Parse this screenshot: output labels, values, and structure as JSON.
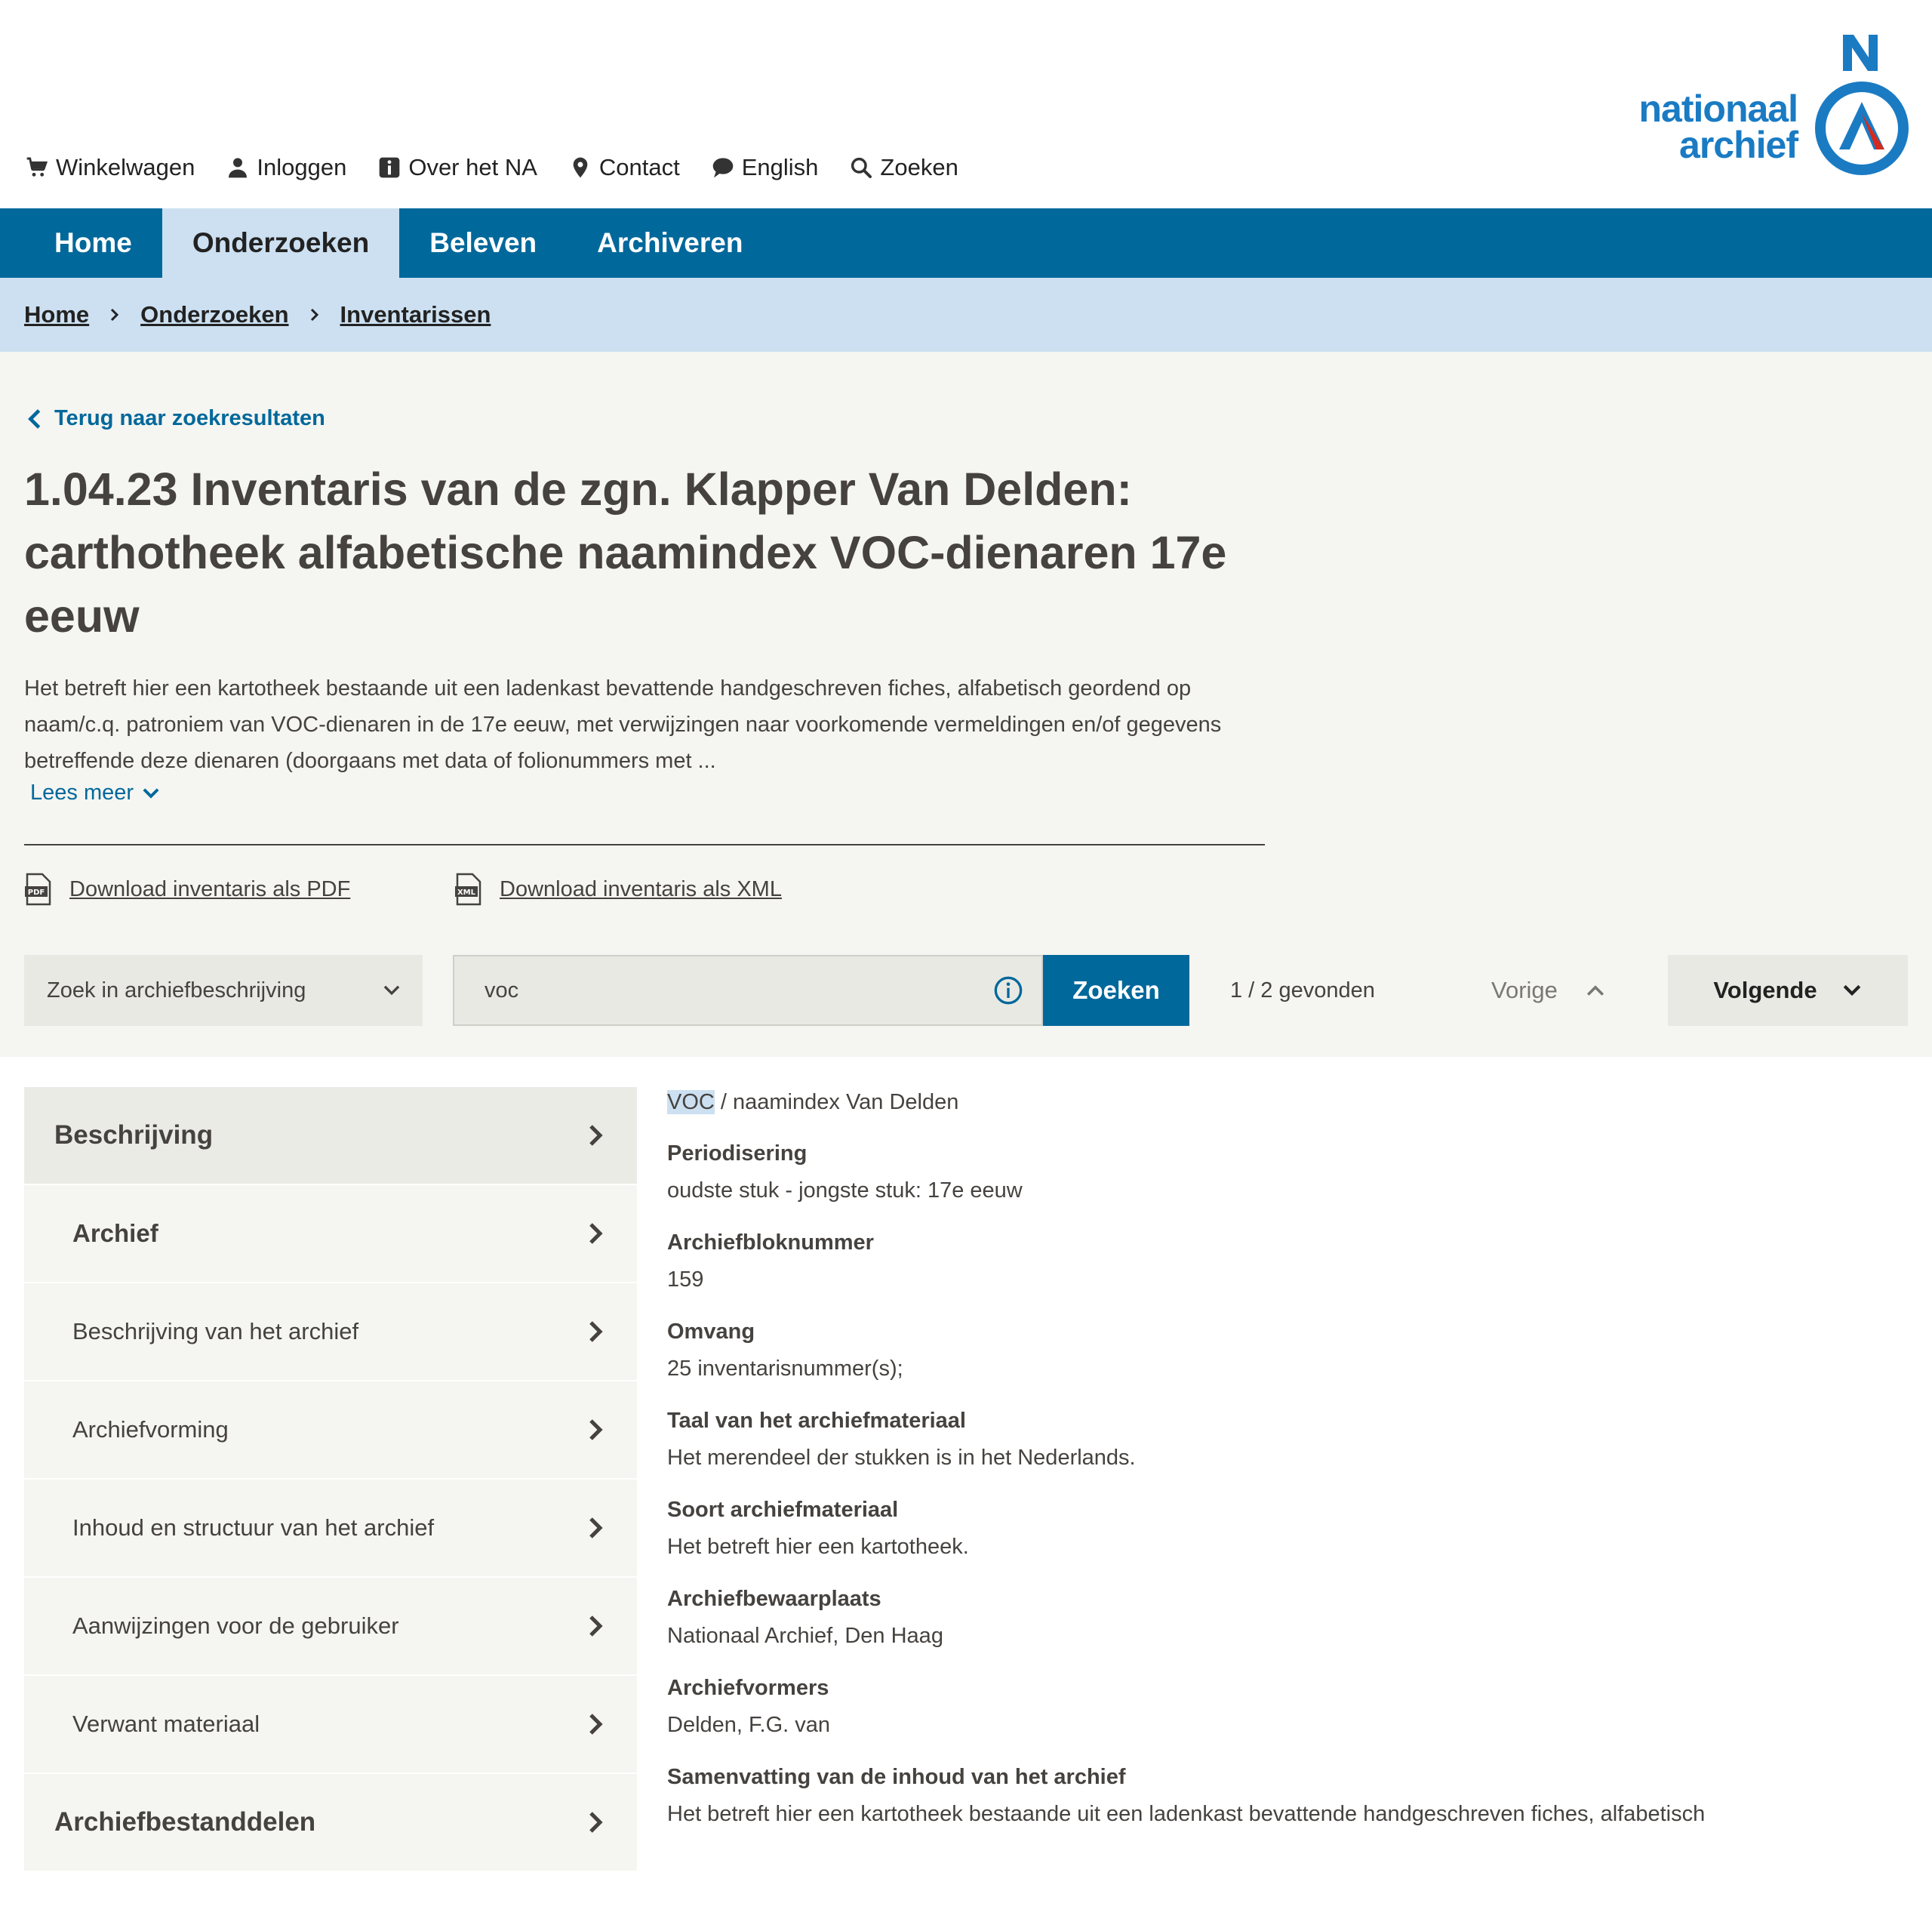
{
  "utility": {
    "links": [
      {
        "label": "Winkelwagen",
        "icon": "cart-icon"
      },
      {
        "label": "Inloggen",
        "icon": "user-icon"
      },
      {
        "label": "Over het NA",
        "icon": "info-icon"
      },
      {
        "label": "Contact",
        "icon": "location-pin-icon"
      },
      {
        "label": "English",
        "icon": "speech-bubble-icon"
      },
      {
        "label": "Zoeken",
        "icon": "search-icon"
      }
    ]
  },
  "logo": {
    "line1": "nationaal",
    "line2": "archief",
    "brand_color": "#1a7bc3",
    "accent_color": "#d52b1e"
  },
  "mainnav": {
    "items": [
      {
        "label": "Home"
      },
      {
        "label": "Onderzoeken"
      },
      {
        "label": "Beleven"
      },
      {
        "label": "Archiveren"
      }
    ],
    "active": "Onderzoeken",
    "color": "#01689b"
  },
  "breadcrumb": [
    "Home",
    "Onderzoeken",
    "Inventarissen"
  ],
  "hero": {
    "back_label": "Terug naar zoekresultaten",
    "title": "1.04.23 Inventaris van de zgn. Klapper Van Delden: carthotheek alfabetische naamindex VOC-dienaren 17e eeuw",
    "intro": "Het betreft hier een kartotheek bestaande uit een ladenkast bevattende handgeschreven fiches, alfabetisch geordend op naam/c.q. patroniem van VOC-dienaren in de 17e eeuw, met verwijzingen naar voorkomende vermeldingen en/of gegevens betreffende deze dienaren (doorgaans met data of folionummers met ...",
    "read_more": "Lees meer",
    "download_pdf": "Download inventaris als PDF",
    "download_xml": "Download inventaris als XML"
  },
  "search": {
    "scope": "Zoek in archiefbeschrijving",
    "value": "voc",
    "button": "Zoeken",
    "count": "1 / 2 gevonden",
    "prev": "Vorige",
    "next": "Volgende"
  },
  "sidebar": {
    "items": [
      {
        "label": "Beschrijving",
        "level": 0
      },
      {
        "label": "Archief",
        "level": 1
      },
      {
        "label": "Beschrijving van het archief",
        "level": 2
      },
      {
        "label": "Archiefvorming",
        "level": 2
      },
      {
        "label": "Inhoud en structuur van het archief",
        "level": 2
      },
      {
        "label": "Aanwijzingen voor de gebruiker",
        "level": 2
      },
      {
        "label": "Verwant materiaal",
        "level": 2
      },
      {
        "label": "Archiefbestanddelen",
        "level": 0
      }
    ]
  },
  "content": {
    "path_highlight": "VOC",
    "path_rest": " / naamindex Van Delden",
    "fields": [
      {
        "label": "Periodisering",
        "value": "oudste stuk - jongste stuk: 17e eeuw"
      },
      {
        "label": "Archiefbloknummer",
        "value": "159"
      },
      {
        "label": "Omvang",
        "value": "25 inventarisnummer(s);"
      },
      {
        "label": "Taal van het archiefmateriaal",
        "value": "Het merendeel der stukken is in het Nederlands."
      },
      {
        "label": "Soort archiefmateriaal",
        "value": "Het betreft hier een kartotheek."
      },
      {
        "label": "Archiefbewaarplaats",
        "value": "Nationaal Archief, Den Haag"
      },
      {
        "label": "Archiefvormers",
        "value": "Delden, F.G. van"
      },
      {
        "label": "Samenvatting van de inhoud van het archief",
        "value": "Het betreft hier een kartotheek bestaande uit een ladenkast bevattende handgeschreven fiches, alfabetisch"
      }
    ]
  }
}
